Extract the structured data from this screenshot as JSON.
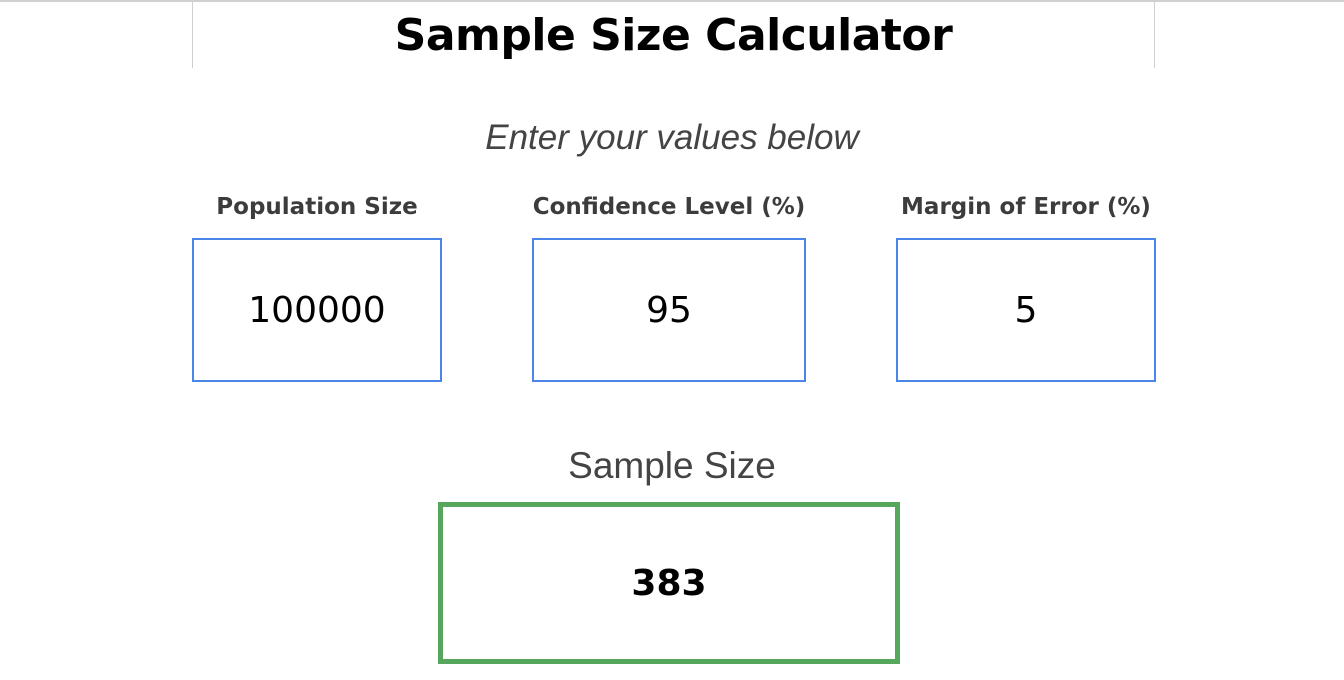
{
  "header": {
    "title": "Sample Size Calculator"
  },
  "form": {
    "instructions": "Enter your values below",
    "fields": [
      {
        "label": "Population Size",
        "value": "100000"
      },
      {
        "label": "Confidence Level (%)",
        "value": "95"
      },
      {
        "label": "Margin of Error (%)",
        "value": "5"
      }
    ]
  },
  "result": {
    "label": "Sample Size",
    "value": "383"
  },
  "colors": {
    "input_border": "#4a86e8",
    "result_border": "#57a65e",
    "label_text": "#3c3c3c"
  }
}
